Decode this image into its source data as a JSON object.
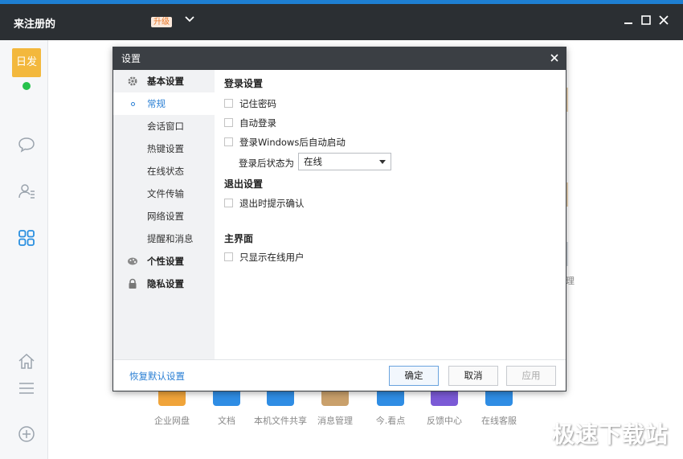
{
  "app": {
    "name": "来注册的",
    "upgrade_badge": "升级"
  },
  "sidebar": {
    "avatar_text": "日发",
    "icons": [
      "chat-icon",
      "contacts-icon",
      "apps-icon",
      "home-icon",
      "menu-icon",
      "add-icon"
    ]
  },
  "bottom_apps": [
    {
      "label": "企业网盘",
      "color": "#f0a43a"
    },
    {
      "label": "文档",
      "color": "#2f8de4"
    },
    {
      "label": "本机文件共享",
      "color": "#2f8de4"
    },
    {
      "label": "消息管理",
      "color": "#c9a06b"
    },
    {
      "label": "今.看点",
      "color": "#2f8de4"
    },
    {
      "label": "反馈中心",
      "color": "#7b5ad6"
    },
    {
      "label": "在线客服",
      "color": "#2f8de4"
    }
  ],
  "background_partial_text": "理",
  "watermark": "极速下载站",
  "dialog": {
    "title": "设置",
    "nav": {
      "basic": "基本设置",
      "sub": [
        "常规",
        "会话窗口",
        "热键设置",
        "在线状态",
        "文件传输",
        "网络设置",
        "提醒和消息"
      ],
      "personal": "个性设置",
      "privacy": "隐私设置"
    },
    "content": {
      "login_section": "登录设置",
      "remember_password": "记住密码",
      "auto_login": "自动登录",
      "autostart": "登录Windows后自动启动",
      "status_label": "登录后状态为",
      "status_value": "在线",
      "logout_section": "退出设置",
      "logout_confirm": "退出时提示确认",
      "main_section": "主界面",
      "online_only": "只显示在线用户"
    },
    "footer": {
      "restore": "恢复默认设置",
      "ok": "确定",
      "cancel": "取消",
      "apply": "应用"
    }
  }
}
